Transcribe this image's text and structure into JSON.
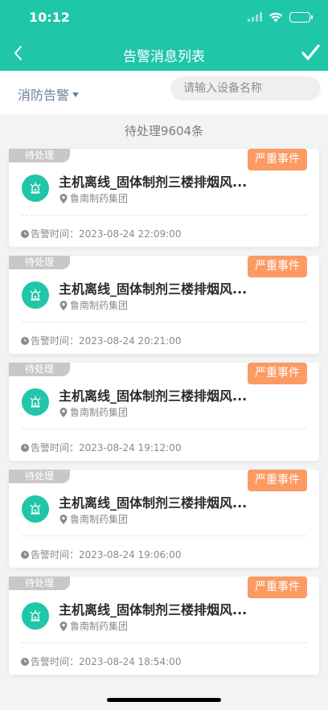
{
  "status_bar": {
    "time": "10:12"
  },
  "nav": {
    "title": "告警消息列表"
  },
  "filter": {
    "selected": "消防告警",
    "search_placeholder": "请输入设备名称"
  },
  "summary": "待处理9604条",
  "colors": {
    "brand": "#20c6a8",
    "badge": "#fb9a63",
    "tag": "#c8c8c8",
    "filter_text": "#6b7f9e"
  },
  "alarms": [
    {
      "status": "待处理",
      "severity": "严重事件",
      "title": "主机离线_固体制剂三楼排烟风...",
      "location": "鲁南制药集团",
      "time": "告警时间：2023-08-24 22:09:00"
    },
    {
      "status": "待处理",
      "severity": "严重事件",
      "title": "主机离线_固体制剂三楼排烟风...",
      "location": "鲁南制药集团",
      "time": "告警时间：2023-08-24 20:21:00"
    },
    {
      "status": "待处理",
      "severity": "严重事件",
      "title": "主机离线_固体制剂三楼排烟风...",
      "location": "鲁南制药集团",
      "time": "告警时间：2023-08-24 19:12:00"
    },
    {
      "status": "待处理",
      "severity": "严重事件",
      "title": "主机离线_固体制剂三楼排烟风...",
      "location": "鲁南制药集团",
      "time": "告警时间：2023-08-24 19:06:00"
    },
    {
      "status": "待处理",
      "severity": "严重事件",
      "title": "主机离线_固体制剂三楼排烟风...",
      "location": "鲁南制药集团",
      "time": "告警时间：2023-08-24 18:54:00"
    }
  ]
}
